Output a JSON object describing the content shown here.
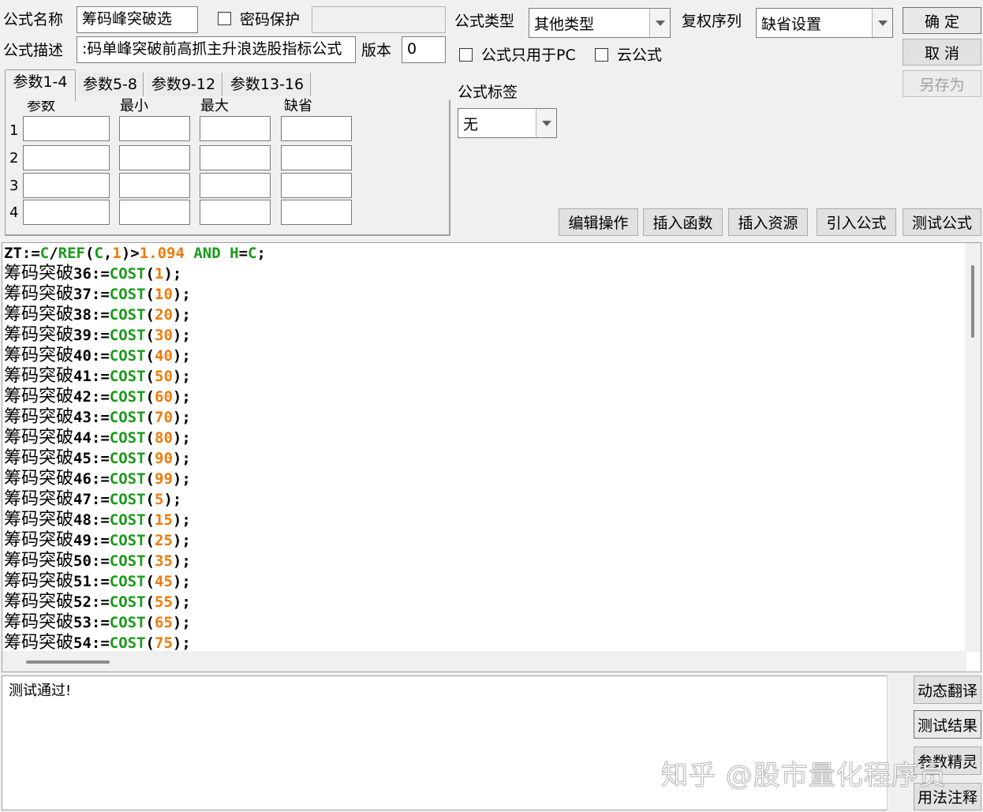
{
  "header": {
    "name_label": "公式名称",
    "name_value": "筹码峰突破选",
    "password_label": "密码保护",
    "password_checked": false,
    "password_value": "",
    "type_label": "公式类型",
    "type_value": "其他类型",
    "rights_label": "复权序列",
    "rights_value": "缺省设置",
    "desc_label": "公式描述",
    "desc_value": "码单峰突破前高抓主升浪选股指标公式:",
    "version_label": "版本",
    "version_value": "0",
    "pc_only_label": "公式只用于PC",
    "pc_only_checked": false,
    "cloud_label": "云公式",
    "cloud_checked": false,
    "tag_label": "公式标签",
    "tag_value": "无"
  },
  "buttons": {
    "ok": "确  定",
    "cancel": "取  消",
    "save_as": "另存为",
    "edit_ops": "编辑操作",
    "insert_func": "插入函数",
    "insert_res": "插入资源",
    "import_formula": "引入公式",
    "test_formula": "测试公式",
    "dynamic_translate": "动态翻译",
    "test_result": "测试结果",
    "param_wizard": "参数精灵",
    "usage_notes": "用法注释"
  },
  "params": {
    "tabs": [
      "参数1-4",
      "参数5-8",
      "参数9-12",
      "参数13-16"
    ],
    "active_tab": 0,
    "columns": [
      "参数",
      "最小",
      "最大",
      "缺省"
    ],
    "rows": [
      "1",
      "2",
      "3",
      "4"
    ]
  },
  "code": {
    "first_line": [
      {
        "t": "ZT:=",
        "c": "id"
      },
      {
        "t": "C",
        "c": "fn"
      },
      {
        "t": "/",
        "c": "op"
      },
      {
        "t": "REF",
        "c": "fn"
      },
      {
        "t": "(",
        "c": "op"
      },
      {
        "t": "C",
        "c": "fn"
      },
      {
        "t": ",",
        "c": "op"
      },
      {
        "t": "1",
        "c": "num"
      },
      {
        "t": ")>",
        "c": "op"
      },
      {
        "t": "1.094",
        "c": "num"
      },
      {
        "t": " ",
        "c": "op"
      },
      {
        "t": "AND",
        "c": "fn"
      },
      {
        "t": " H",
        "c": "fn"
      },
      {
        "t": "=",
        "c": "op"
      },
      {
        "t": "C",
        "c": "fn"
      },
      {
        "t": ";",
        "c": "op"
      }
    ],
    "var_prefix": "筹码突破",
    "func": "COST",
    "lines": [
      {
        "n": "36",
        "arg": "1"
      },
      {
        "n": "37",
        "arg": "10"
      },
      {
        "n": "38",
        "arg": "20"
      },
      {
        "n": "39",
        "arg": "30"
      },
      {
        "n": "40",
        "arg": "40"
      },
      {
        "n": "41",
        "arg": "50"
      },
      {
        "n": "42",
        "arg": "60"
      },
      {
        "n": "43",
        "arg": "70"
      },
      {
        "n": "44",
        "arg": "80"
      },
      {
        "n": "45",
        "arg": "90"
      },
      {
        "n": "46",
        "arg": "99"
      },
      {
        "n": "47",
        "arg": "5"
      },
      {
        "n": "48",
        "arg": "15"
      },
      {
        "n": "49",
        "arg": "25"
      },
      {
        "n": "50",
        "arg": "35"
      },
      {
        "n": "51",
        "arg": "45"
      },
      {
        "n": "52",
        "arg": "55"
      },
      {
        "n": "53",
        "arg": "65"
      },
      {
        "n": "54",
        "arg": "75"
      }
    ]
  },
  "output": {
    "text": "测试通过!"
  },
  "watermark": "知乎 @股市量化程序员",
  "colors": {
    "function": "#1a9b1a",
    "number": "#f07a0a",
    "identifier": "#000000"
  }
}
